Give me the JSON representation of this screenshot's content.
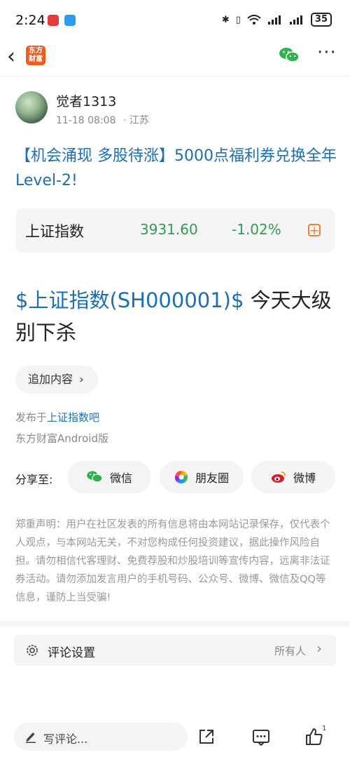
{
  "status_bar": {
    "time": "2:24",
    "battery": "35"
  },
  "nav": {
    "logo_line1": "东方",
    "logo_line2": "财富"
  },
  "post": {
    "author": "觉者1313",
    "date": "11-18 08:08",
    "location": "· 江苏",
    "title": "【机会涌现 多股待涨】5000点福利券兑换全年Level-2!",
    "stock_card": {
      "name": "上证指数",
      "price": "3931.60",
      "change": "-1.02%"
    },
    "body_stock": "$上证指数(SH000001)$",
    "body_text": " 今天大级别下杀",
    "add_content_label": "追加内容",
    "published_prefix": "发布于",
    "published_bar": "上证指数吧",
    "client": "东方财富Android版"
  },
  "share": {
    "label": "分享至:",
    "wechat": "微信",
    "moments": "朋友圈",
    "weibo": "微博"
  },
  "disclaimer": "郑重声明：用户在社区发表的所有信息将由本网站记录保存，仅代表个人观点，与本网站无关，不对您构成任何投资建议，据此操作风险自担。请勿相信代客理财、免费荐股和炒股培训等宣传内容，远离非法证券活动。请勿添加发言用户的手机号码、公众号、微博、微信及QQ等信息，谨防上当受骗!",
  "comment_settings": {
    "label": "评论设置",
    "value": "所有人"
  },
  "bottom_bar": {
    "comment_placeholder": "写评论...",
    "like_count": "1"
  },
  "colors": {
    "link": "#1a6fbb",
    "down": "#2e9e4f",
    "accent": "#f08030",
    "brand": "#ef5b20"
  }
}
